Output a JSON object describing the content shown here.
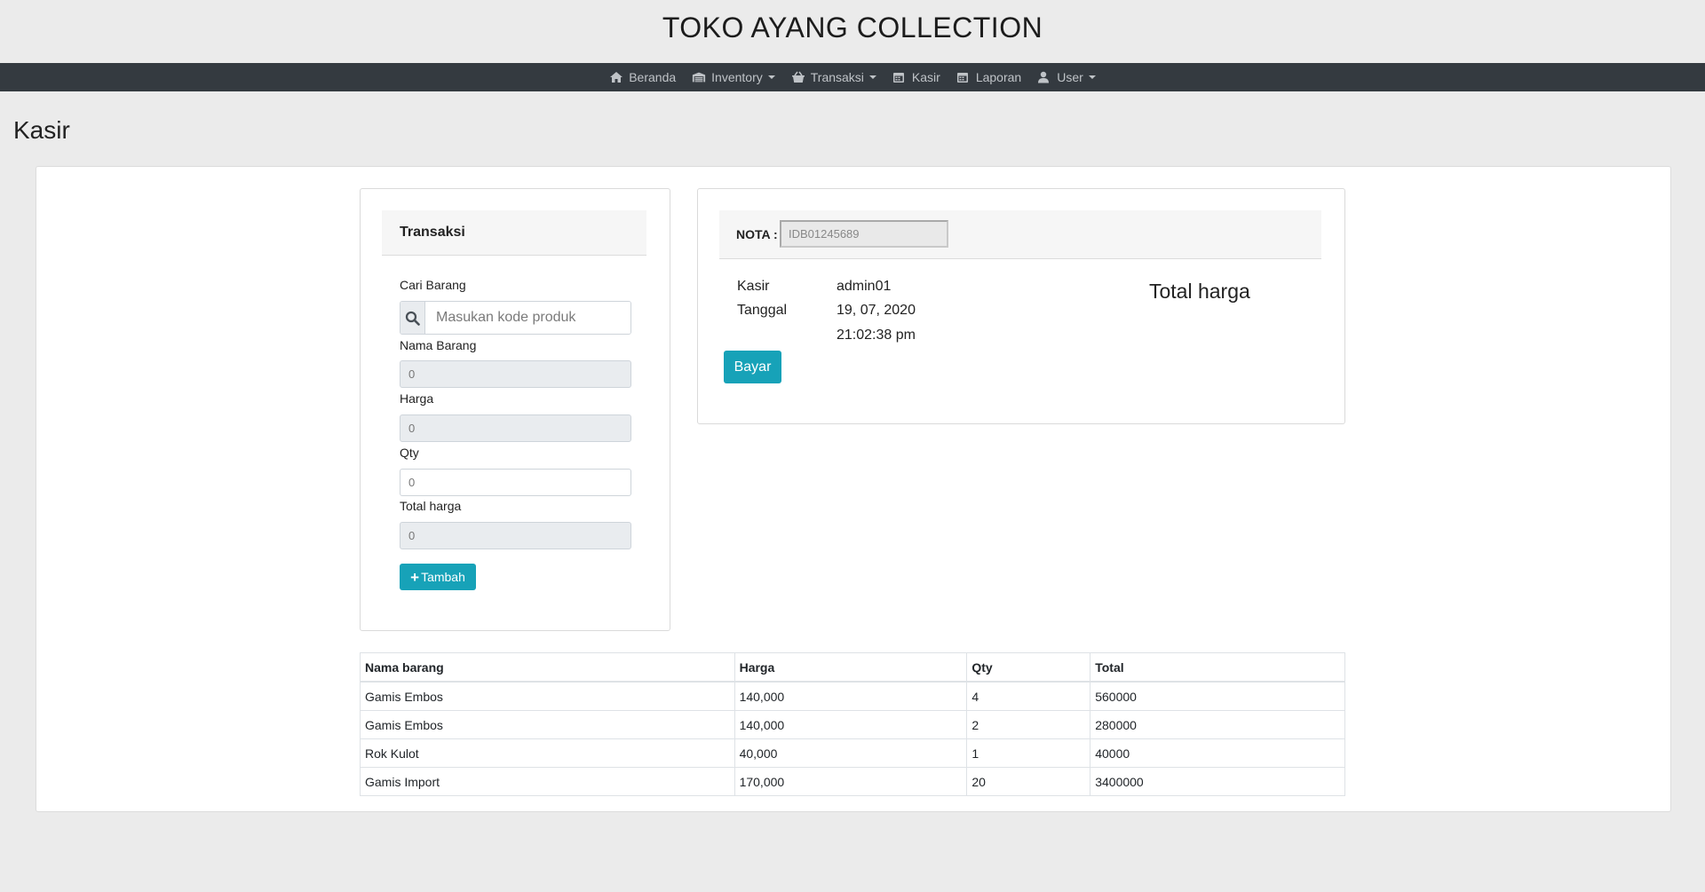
{
  "site": {
    "title": "TOKO AYANG COLLECTION"
  },
  "nav": {
    "items": [
      {
        "label": "Beranda",
        "icon": "home-icon"
      },
      {
        "label": "Inventory",
        "icon": "warehouse-icon"
      },
      {
        "label": "Transaksi",
        "icon": "basket-icon"
      },
      {
        "label": "Kasir",
        "icon": "calendar-icon"
      },
      {
        "label": "Laporan",
        "icon": "calendar-icon"
      },
      {
        "label": "User",
        "icon": "user-icon"
      }
    ]
  },
  "page": {
    "title": "Kasir"
  },
  "transaksi": {
    "header": "Transaksi",
    "cari_label": "Cari Barang",
    "search_placeholder": "Masukan kode produk",
    "nama_label": "Nama Barang",
    "nama_value": "0",
    "harga_label": "Harga",
    "harga_value": "0",
    "qty_label": "Qty",
    "qty_value": "0",
    "total_label": "Total harga",
    "total_value": "0",
    "tambah_label": "Tambah"
  },
  "nota": {
    "label": "NOTA :",
    "value": "IDB01245689",
    "kasir_label": "Kasir",
    "kasir_value": "admin01",
    "tanggal_label": "Tanggal",
    "tanggal_value": "19, 07, 2020",
    "time_value": "21:02:38 pm",
    "total_heading": "Total harga",
    "bayar_label": "Bayar"
  },
  "table": {
    "headers": [
      "Nama barang",
      "Harga",
      "Qty",
      "Total"
    ],
    "rows": [
      [
        "Gamis Embos",
        "140,000",
        "4",
        "560000"
      ],
      [
        "Gamis Embos",
        "140,000",
        "2",
        "280000"
      ],
      [
        "Rok Kulot",
        "40,000",
        "1",
        "40000"
      ],
      [
        "Gamis Import",
        "170,000",
        "20",
        "3400000"
      ]
    ]
  },
  "colors": {
    "navbar": "#343a40",
    "accent": "#17a2b8",
    "background": "#ebebeb"
  }
}
